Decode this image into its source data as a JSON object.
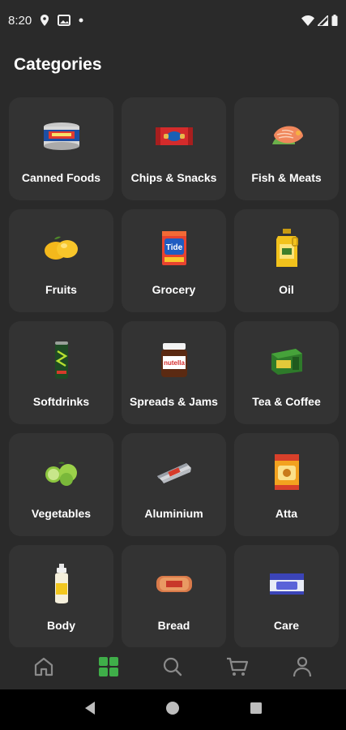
{
  "status_bar": {
    "time": "8:20",
    "icons_left": [
      "location-icon",
      "image-icon",
      "dot-icon"
    ],
    "icons_right": [
      "wifi-icon",
      "signal-icon",
      "battery-icon"
    ]
  },
  "page": {
    "title": "Categories"
  },
  "categories": [
    {
      "label": "Canned Foods",
      "icon": "canned-foods-icon"
    },
    {
      "label": "Chips & Snacks",
      "icon": "chips-snacks-icon"
    },
    {
      "label": "Fish & Meats",
      "icon": "fish-meats-icon"
    },
    {
      "label": "Fruits",
      "icon": "fruits-icon"
    },
    {
      "label": "Grocery",
      "icon": "grocery-icon"
    },
    {
      "label": "Oil",
      "icon": "oil-icon"
    },
    {
      "label": "Softdrinks",
      "icon": "softdrinks-icon"
    },
    {
      "label": "Spreads & Jams",
      "icon": "spreads-jams-icon"
    },
    {
      "label": "Tea & Coffee",
      "icon": "tea-coffee-icon"
    },
    {
      "label": "Vegetables",
      "icon": "vegetables-icon"
    },
    {
      "label": "Aluminium",
      "icon": "aluminium-icon"
    },
    {
      "label": "Atta",
      "icon": "atta-icon"
    },
    {
      "label": "Body",
      "icon": "body-icon"
    },
    {
      "label": "Bread",
      "icon": "bread-icon"
    },
    {
      "label": "Care",
      "icon": "care-icon"
    }
  ],
  "bottom_nav": {
    "items": [
      {
        "icon": "home-icon",
        "active": false
      },
      {
        "icon": "categories-icon",
        "active": true
      },
      {
        "icon": "search-icon",
        "active": false
      },
      {
        "icon": "cart-icon",
        "active": false
      },
      {
        "icon": "profile-icon",
        "active": false
      }
    ],
    "active_color": "#3fae49",
    "inactive_color": "#8a8a8a"
  },
  "system_nav": {
    "buttons": [
      "back-icon",
      "home-circle-icon",
      "recents-icon"
    ]
  },
  "colors": {
    "background": "#2a2a2a",
    "tile": "#333333",
    "text": "#ffffff"
  }
}
